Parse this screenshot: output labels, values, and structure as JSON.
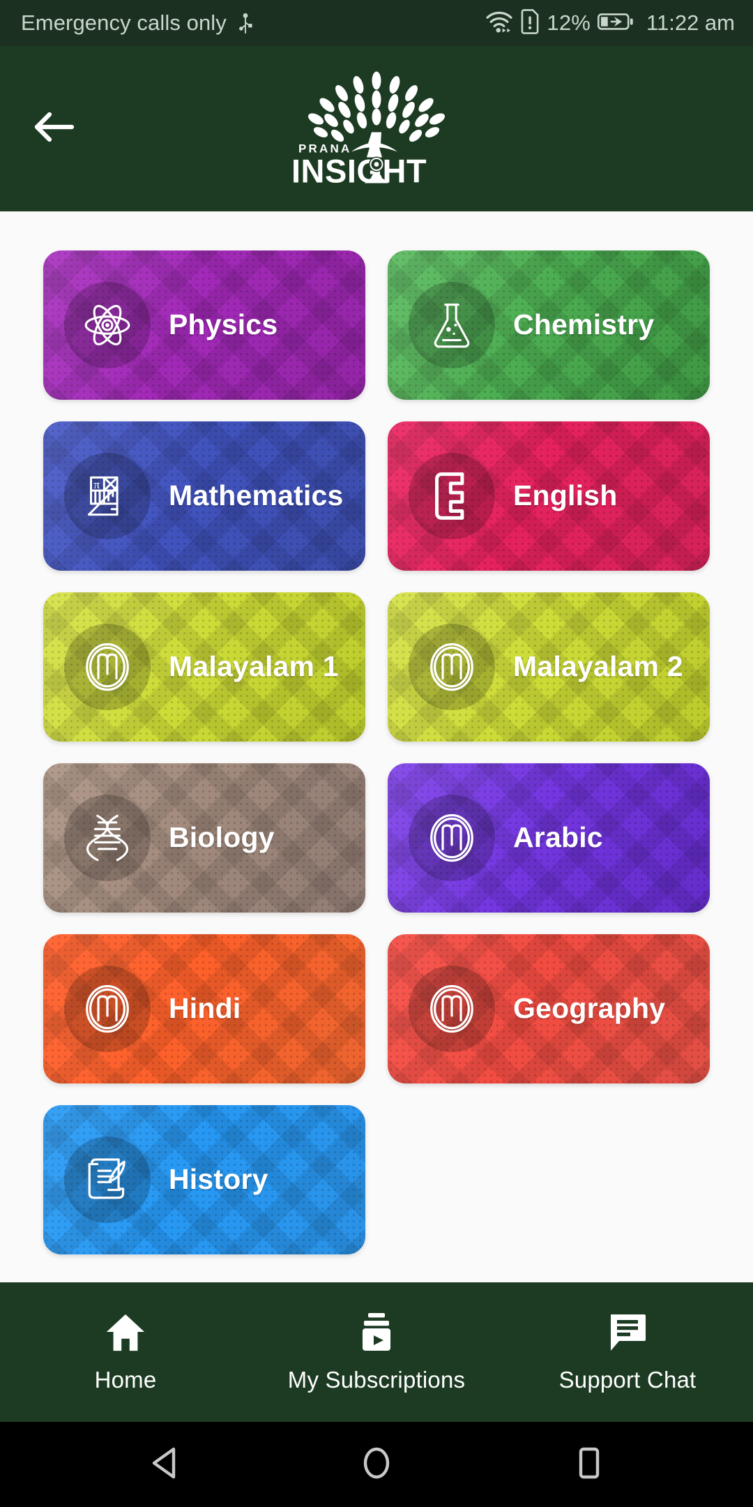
{
  "status_bar": {
    "carrier_text": "Emergency calls only",
    "usb_icon": "usb-icon",
    "wifi_icon": "wifi-icon",
    "sim_alert_icon": "sim-alert-icon",
    "battery_percent": "12%",
    "battery_icon": "battery-charging-icon",
    "time": "11:22 am",
    "bg_color": "#1b3020",
    "text_color": "#c9d6cb"
  },
  "app_bar": {
    "back_icon": "arrow-left-icon",
    "logo": {
      "icon": "tree-logo-icon",
      "tagline": "PRANA",
      "wordmark": "INSIGHT"
    },
    "bg_color": "#1d3b23"
  },
  "subjects": [
    {
      "label": "Physics",
      "icon": "atom-icon",
      "color": "#a62bbd",
      "color2": "#9c27b0"
    },
    {
      "label": "Chemistry",
      "icon": "flask-icon",
      "color": "#4caf50",
      "color2": "#43a047"
    },
    {
      "label": "Mathematics",
      "icon": "geometry-icon",
      "color": "#4254c4",
      "color2": "#3f51b5"
    },
    {
      "label": "English",
      "icon": "letter-e-icon",
      "color": "#e91e5f",
      "color2": "#e0245e"
    },
    {
      "label": "Malayalam 1",
      "icon": "circled-m-icon",
      "color": "#cddc39",
      "color2": "#c6d72e"
    },
    {
      "label": "Malayalam 2",
      "icon": "circled-m-icon",
      "color": "#cddc39",
      "color2": "#c6d72e"
    },
    {
      "label": "Biology",
      "icon": "dna-icon",
      "color": "#a1887f",
      "color2": "#998278"
    },
    {
      "label": "Arabic",
      "icon": "circled-m-icon",
      "color": "#7236e0",
      "color2": "#6a2fd6"
    },
    {
      "label": "Hindi",
      "icon": "circled-m-icon",
      "color": "#ff5722",
      "color2": "#fb5420"
    },
    {
      "label": "Geography",
      "icon": "circled-m-icon",
      "color": "#f4453c",
      "color2": "#ef4136"
    },
    {
      "label": "History",
      "icon": "scroll-quill-icon",
      "color": "#2196f3",
      "color2": "#2092ef"
    }
  ],
  "bottom_nav": [
    {
      "label": "Home",
      "icon": "home-icon"
    },
    {
      "label": "My Subscriptions",
      "icon": "subscriptions-icon"
    },
    {
      "label": "Support Chat",
      "icon": "chat-icon"
    }
  ],
  "system_nav": [
    {
      "name": "back",
      "icon": "triangle-back-icon"
    },
    {
      "name": "home",
      "icon": "circle-home-icon"
    },
    {
      "name": "recents",
      "icon": "square-recents-icon"
    }
  ]
}
